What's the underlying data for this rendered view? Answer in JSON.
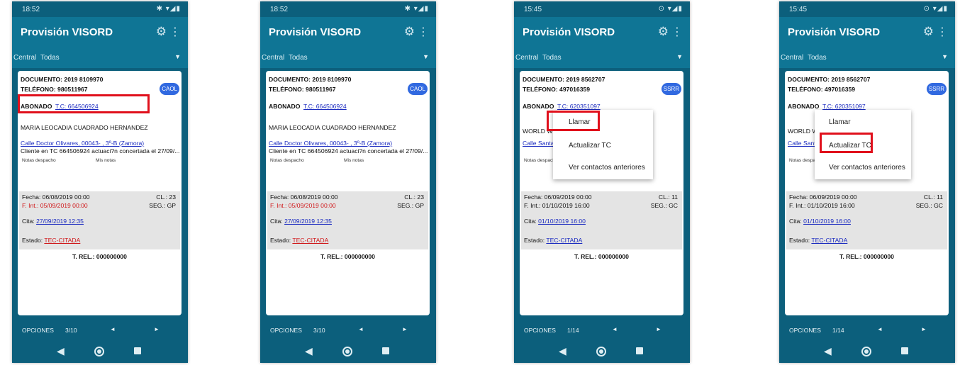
{
  "common": {
    "app_title": "Provisión VISORD",
    "filter_label": "Central",
    "filter_value": "Todas",
    "notes_dispatch": "Notas despacho",
    "my_notes": "Mis notas",
    "trel": "T. REL.: 000000000",
    "opciones": "OPCIONES",
    "prev": "◄",
    "next": "►",
    "icons": [
      "settings-gear-icon",
      "overflow-menu-icon",
      "dropdown-arrow-icon",
      "back-nav-icon",
      "home-nav-icon",
      "recents-nav-icon"
    ]
  },
  "phones": [
    {
      "time": "18:52",
      "doc": "DOCUMENTO: 2019 8109970",
      "tel": "TELÉFONO: 980511967",
      "badge": "CAOL",
      "abonado": "ABONADO",
      "tc": "T.C: 664506924",
      "name": "MARIA LEOCADIA CUADRADO HERNANDEZ",
      "address": "Calle Doctor Olivares, 00043- , 3º-B (Zamora)",
      "note": "Cliente en TC 664506924 actuaci?n concertada el 27/09/...",
      "fecha": "Fecha: 06/08/2019 00:00",
      "cl": "CL.: 23",
      "fint": "F. Int.: 05/09/2019 00:00",
      "seg": "SEG.: GP",
      "cita_label": "Cita:",
      "cita": "27/09/2019 12:35",
      "estado_label": "Estado:",
      "estado": "TEC-CITADA",
      "page": "3/10"
    },
    {
      "time": "18:52",
      "doc": "DOCUMENTO: 2019 8109970",
      "tel": "TELÉFONO: 980511967",
      "badge": "CAOL",
      "abonado": "ABONADO",
      "tc": "T.C: 664506924",
      "name": "MARIA LEOCADIA CUADRADO HERNANDEZ",
      "address": "Calle Doctor Olivares, 00043- , 3º-B (Zamora)",
      "note": "Cliente en TC 664506924 actuaci?n concertada el 27/09/...",
      "fecha": "Fecha: 06/08/2019 00:00",
      "cl": "CL.: 23",
      "fint": "F. Int.: 05/09/2019 00:00",
      "seg": "SEG.: GP",
      "cita_label": "Cita:",
      "cita": "27/09/2019 12:35",
      "estado_label": "Estado:",
      "estado": "TEC-CITADA",
      "page": "3/10"
    },
    {
      "time": "15:45",
      "doc": "DOCUMENTO: 2019 8562707",
      "tel": "TELÉFONO: 497016359",
      "badge": "SSRR",
      "abonado": "ABONADO",
      "tc": "T.C: 620351097",
      "name": "WORLD WIDE",
      "address": "Calle Santa C",
      "note": "",
      "fecha": "Fecha: 06/09/2019 00:00",
      "cl": "CL.: 11",
      "fint": "F. Int.: 01/10/2019 16:00",
      "seg": "SEG.: GC",
      "cita_label": "Cita:",
      "cita": "01/10/2019 16:00",
      "estado_label": "Estado:",
      "estado": "TEC-CITADA",
      "page": "1/14",
      "menu": [
        "Llamar",
        "Actualizar TC",
        "Ver contactos anteriores"
      ]
    },
    {
      "time": "15:45",
      "doc": "DOCUMENTO: 2019 8562707",
      "tel": "TELÉFONO: 497016359",
      "badge": "SSRR",
      "abonado": "ABONADO",
      "tc": "T.C: 620351097",
      "name": "WORLD WIDE",
      "address": "Calle Santa",
      "note": "",
      "fecha": "Fecha: 06/09/2019 00:00",
      "cl": "CL.: 11",
      "fint": "F. Int.: 01/10/2019 16:00",
      "seg": "SEG.: GC",
      "cita_label": "Cita:",
      "cita": "01/10/2019 16:00",
      "estado_label": "Estado:",
      "estado": "TEC-CITADA",
      "page": "1/14",
      "menu": [
        "Llamar",
        "Actualizar TC",
        "Ver contactos anteriores"
      ]
    }
  ]
}
